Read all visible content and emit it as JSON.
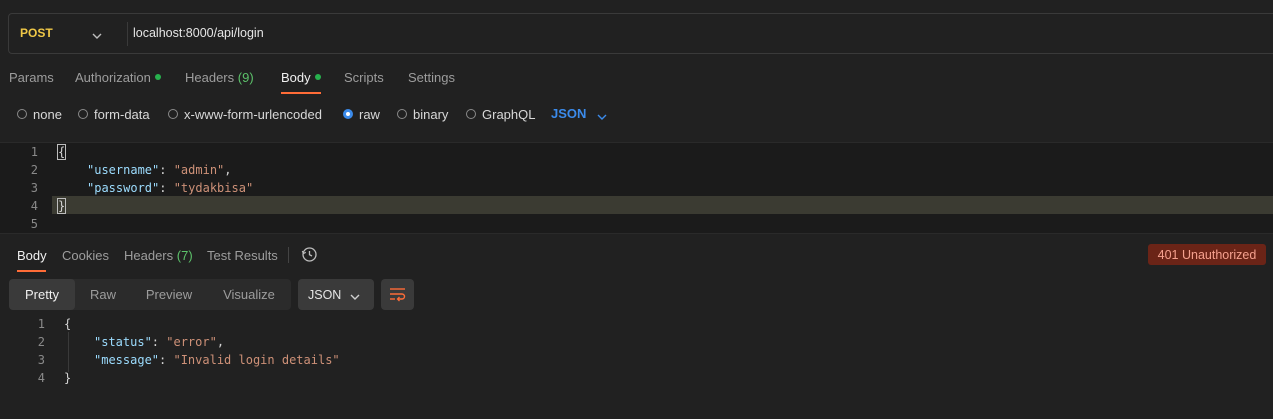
{
  "request": {
    "method": "POST",
    "url": "localhost:8000/api/login"
  },
  "request_tabs": [
    {
      "label": "Params"
    },
    {
      "label": "Authorization"
    },
    {
      "label": "Headers",
      "count": "(9)"
    },
    {
      "label": "Body"
    },
    {
      "label": "Scripts"
    },
    {
      "label": "Settings"
    }
  ],
  "body_types": [
    "none",
    "form-data",
    "x-www-form-urlencoded",
    "raw",
    "binary",
    "GraphQL"
  ],
  "body_selected": "raw",
  "body_language": "JSON",
  "request_body": {
    "line_numbers": [
      "1",
      "2",
      "3",
      "4",
      "5"
    ],
    "open_brace": "{",
    "close_brace": "}",
    "username_key": "\"username\"",
    "username_value": "\"admin\"",
    "password_key": "\"password\"",
    "password_value": "\"tydakbisa\""
  },
  "response_tabs": [
    {
      "label": "Body"
    },
    {
      "label": "Cookies"
    },
    {
      "label": "Headers",
      "count": "(7)"
    },
    {
      "label": "Test Results"
    }
  ],
  "response_status": "401 Unauthorized",
  "view_modes": [
    "Pretty",
    "Raw",
    "Preview",
    "Visualize"
  ],
  "response_format": "JSON",
  "response_body": {
    "line_numbers": [
      "1",
      "2",
      "3",
      "4"
    ],
    "open_brace": "{",
    "close_brace": "}",
    "status_key": "\"status\"",
    "status_value": "\"error\"",
    "message_key": "\"message\"",
    "message_value": "\"Invalid login details\""
  },
  "colors": {
    "background": "#212121",
    "accent_orange": "#ff6c37",
    "post_method": "#f0c847",
    "json_key": "#9cdcfe",
    "json_string": "#ce9178",
    "status_error_bg": "#6b2417"
  },
  "icons": [
    "chevron-down-icon",
    "history-icon",
    "wrap-lines-icon"
  ]
}
